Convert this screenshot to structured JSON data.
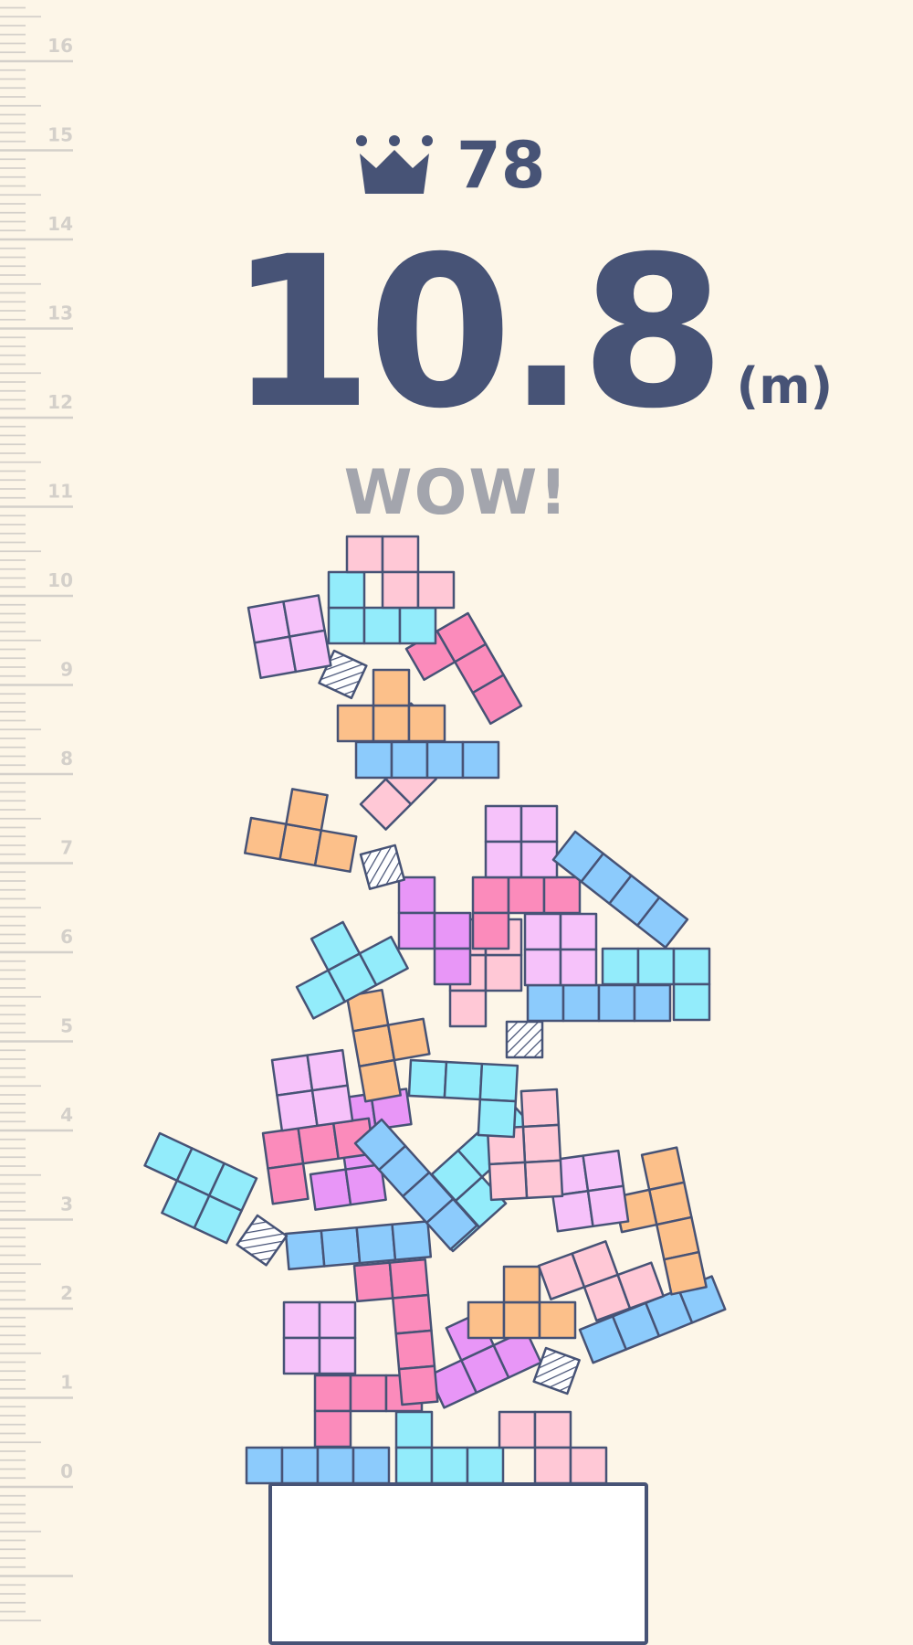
{
  "hud": {
    "best_score": "78",
    "height_value": "10.8",
    "height_unit": "(m)",
    "message": "WOW!"
  },
  "ruler": {
    "labels": [
      "0",
      "1",
      "2",
      "3",
      "4",
      "5",
      "6",
      "7",
      "8",
      "9",
      "10",
      "11",
      "12",
      "13",
      "14",
      "15",
      "16"
    ]
  },
  "icons": {
    "best": "crown-icon"
  },
  "colors": {
    "background": "#fdf6e8",
    "text_dark": "#475376",
    "text_muted": "#a3a5ad",
    "ruler": "#d4d0ca",
    "outline": "#475376",
    "blocks": {
      "light_pink": "#ffc8d6",
      "hot_pink": "#fb8bbb",
      "lilac": "#f6c2fa",
      "violet": "#e896f7",
      "cyan": "#93ecfb",
      "blue": "#8ccbfc",
      "orange": "#fcc08a",
      "hatch": "#ffffff"
    }
  }
}
